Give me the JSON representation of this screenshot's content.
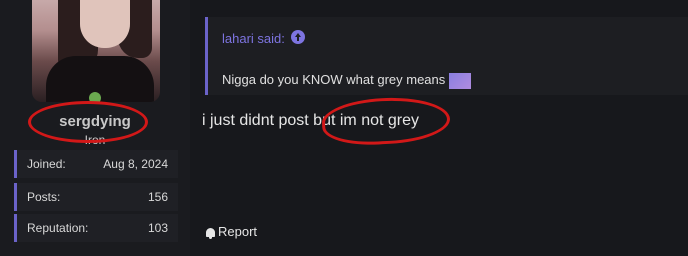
{
  "user": {
    "username": "sergdying",
    "rank": "Iron"
  },
  "stats": [
    {
      "label": "Joined:",
      "value": "Aug 8, 2024"
    },
    {
      "label": "Posts:",
      "value": "156"
    },
    {
      "label": "Reputation:",
      "value": "103"
    }
  ],
  "quote": {
    "author": "lahari said:",
    "text": "Nigga do you KNOW what grey means"
  },
  "post": {
    "text": "i just didnt post but im not grey"
  },
  "actions": {
    "report_label": "Report"
  },
  "colors": {
    "accent": "#6b63c9",
    "annotation": "#d21818",
    "online": "#6aa84f"
  }
}
